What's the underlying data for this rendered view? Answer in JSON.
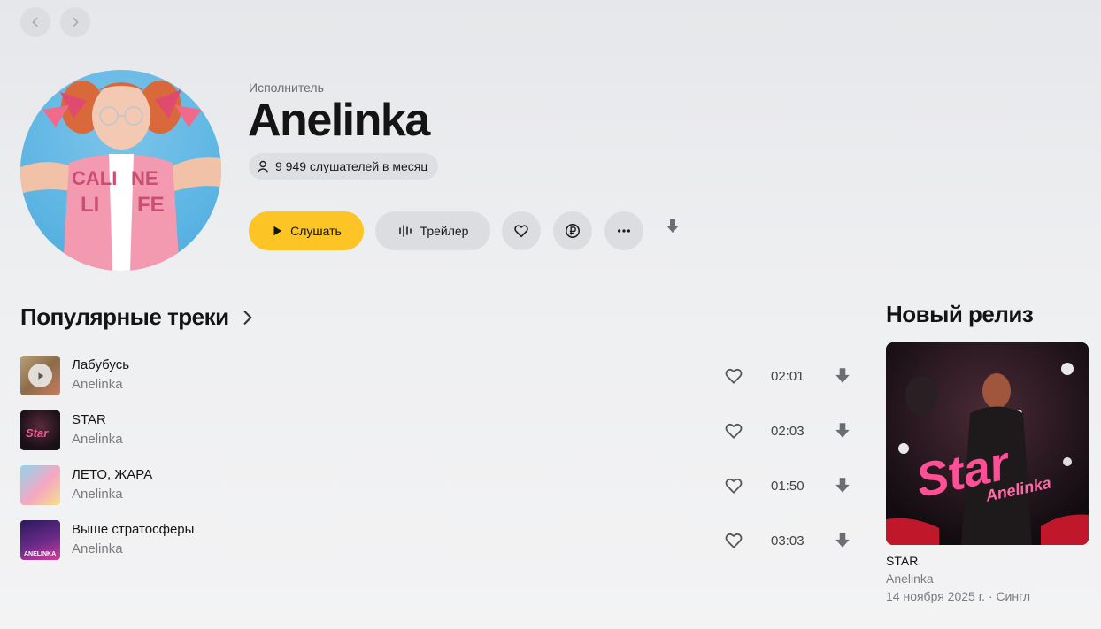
{
  "nav": {
    "back_icon": "chevron-left-icon",
    "forward_icon": "chevron-right-icon"
  },
  "artist": {
    "type_label": "Исполнитель",
    "name": "Anelinka",
    "listeners": "9 949 слушателей в месяц"
  },
  "actions": {
    "play_label": "Слушать",
    "trailer_label": "Трейлер",
    "accent_color": "#fdc426"
  },
  "popular": {
    "title": "Популярные треки",
    "tracks": [
      {
        "title": "Лабубусь",
        "artist": "Anelinka",
        "duration": "02:01"
      },
      {
        "title": "STAR",
        "artist": "Anelinka",
        "duration": "02:03"
      },
      {
        "title": "ЛЕТО, ЖАРА",
        "artist": "Anelinka",
        "duration": "01:50"
      },
      {
        "title": "Выше стратосферы",
        "artist": "Anelinka",
        "duration": "03:03"
      }
    ]
  },
  "release": {
    "section_title": "Новый релиз",
    "cover_text": "Star",
    "cover_artist_text": "Anelinka",
    "name": "STAR",
    "artist": "Anelinka",
    "meta": "14 ноября 2025 г. · Сингл"
  },
  "covers": {
    "track4_caption": "ANELINKA"
  }
}
